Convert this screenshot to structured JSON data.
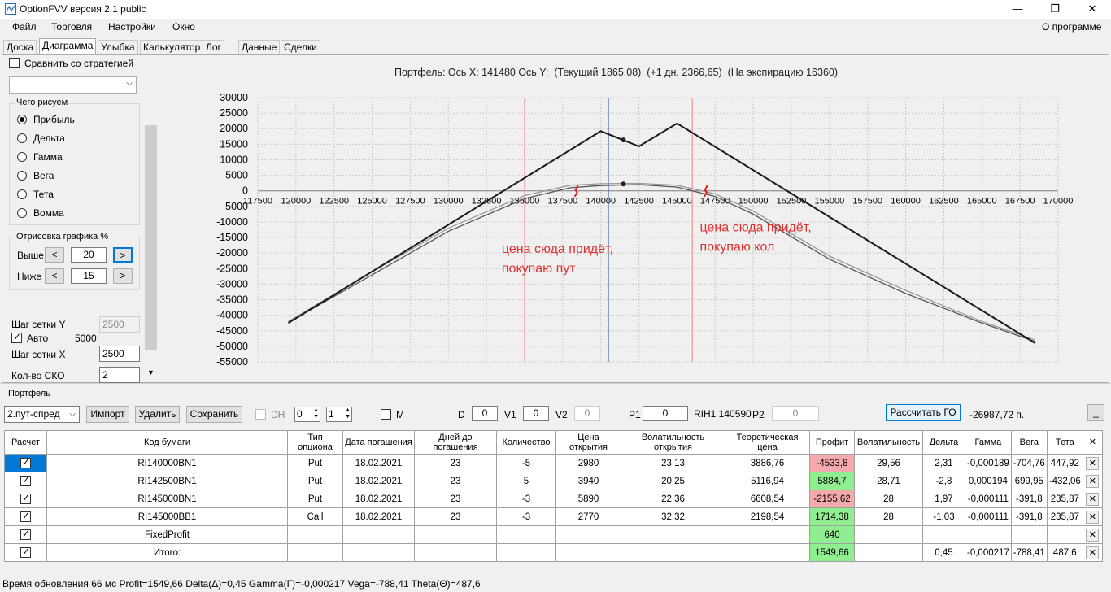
{
  "window": {
    "title": "OptionFVV версия 2.1 public",
    "minimize": "—",
    "maximize": "❐",
    "close": "✕"
  },
  "menu": {
    "items": [
      "Файл",
      "Торговля",
      "Настройки",
      "Окно"
    ],
    "about": "О программе"
  },
  "tabs": [
    "Доска",
    "Диаграмма",
    "Улыбка",
    "Калькулятор",
    "Лог",
    "Данные",
    "Сделки"
  ],
  "active_tab": "Диаграмма",
  "left_panel": {
    "compare_label": "Сравнить со стратегией",
    "draw_group_label": "Чего рисуем",
    "draw_options": [
      "Прибыль",
      "Дельта",
      "Гамма",
      "Вега",
      "Тета",
      "Вомма"
    ],
    "selected_option": "Прибыль",
    "render_group_label": "Отрисовка графика %",
    "above_label": "Выше",
    "above_value": "20",
    "below_label": "Ниже",
    "below_value": "15",
    "grid_y_label": "Шаг сетки Y",
    "grid_y_value": "2500",
    "auto_label": "Авто",
    "auto_value": "5000",
    "grid_x_label": "Шаг сетки X",
    "grid_x_value": "2500",
    "sko_label": "Кол-во СКО",
    "sko_value": "2"
  },
  "chart_header": "Портфель: Ось X: 141480 Ось Y:  (Текущий 1865,08)  (+1 дн. 2366,65)  (На экспирацию 16360)",
  "chart_data": {
    "type": "line",
    "xlim": [
      117500,
      170000
    ],
    "ylim": [
      -55000,
      30000
    ],
    "x_ticks": [
      117500,
      120000,
      122500,
      125000,
      127500,
      130000,
      132500,
      135000,
      137500,
      140000,
      142500,
      145000,
      147500,
      150000,
      152500,
      155000,
      157500,
      160000,
      162500,
      165000,
      167500,
      170000
    ],
    "y_ticks": [
      30000,
      25000,
      20000,
      15000,
      10000,
      5000,
      0,
      -5000,
      -10000,
      -15000,
      -20000,
      -25000,
      -30000,
      -35000,
      -40000,
      -45000,
      -50000,
      -55000
    ],
    "grid": true,
    "series": [
      {
        "color": "#1a1a1a",
        "x": [
          119500,
          140000,
          142500,
          145000,
          168500
        ],
        "y": [
          -42500,
          19200,
          14300,
          21700,
          -49000
        ]
      },
      {
        "color": "#555555",
        "x": [
          119500,
          125000,
          130000,
          135000,
          138000,
          140000,
          141480,
          142500,
          145000,
          147500,
          150000,
          155000,
          160000,
          165000,
          168500
        ],
        "y": [
          -42300,
          -27000,
          -13000,
          -2500,
          1000,
          1700,
          1865,
          2000,
          1200,
          -1800,
          -7500,
          -22000,
          -33000,
          -42500,
          -48500
        ]
      },
      {
        "color": "#999999",
        "x": [
          119500,
          125000,
          130000,
          135000,
          138000,
          140000,
          141480,
          142500,
          145000,
          147500,
          150000,
          155000,
          160000,
          165000,
          168500
        ],
        "y": [
          -42000,
          -26000,
          -12000,
          -1500,
          1800,
          2300,
          2367,
          2400,
          1800,
          -1000,
          -6500,
          -21000,
          -32000,
          -42000,
          -48000
        ]
      }
    ],
    "points": [
      {
        "x": 141480,
        "y": 16360
      },
      {
        "x": 141480,
        "y": 2200
      }
    ],
    "vlines": [
      {
        "x": 135000,
        "color": "#f08080"
      },
      {
        "x": 140500,
        "color": "#4060b0"
      },
      {
        "x": 146000,
        "color": "#f08080"
      }
    ],
    "markers": [
      {
        "x": 138500,
        "y": 0
      },
      {
        "x": 147000,
        "y": 0
      }
    ],
    "annotations": [
      {
        "lines": [
          "цена сюда придёт,",
          "покупаю пут"
        ],
        "x": 133500,
        "y": -20000,
        "color": "#e03030"
      },
      {
        "lines": [
          "цена сюда придёт,",
          "покупаю кол"
        ],
        "x": 146500,
        "y": -13000,
        "color": "#e03030"
      }
    ]
  },
  "portfolio": {
    "label": "Портфель",
    "selected": "2.пут-спред",
    "import": "Импорт",
    "delete": "Удалить",
    "save": "Сохранить",
    "dh_label": "DH",
    "spin1": "0",
    "spin2": "1",
    "m_label": "M",
    "d_label": "D",
    "d_value": "0",
    "v1_label": "V1",
    "v1_value": "0",
    "v2_label": "V2",
    "v2_value": "0",
    "p1_label": "P1",
    "p1_value": "0",
    "rih_label": "RIH1 140590",
    "p2_label": "P2",
    "p2_value": "0",
    "calc_go": "Рассчитать ГО",
    "go_value": "-26987,72 п.",
    "minimize": "_"
  },
  "table": {
    "headers": [
      "Расчет",
      "Код бумаги",
      "Тип опциона",
      "Дата погашения",
      "Дней до погашения",
      "Количество",
      "Цена открытия",
      "Волатильность открытия",
      "Теоретическая цена",
      "Профит",
      "Волатильность",
      "Дельта",
      "Гамма",
      "Вега",
      "Тета",
      "✕"
    ],
    "rows": [
      [
        "",
        "RI140000BN1",
        "Put",
        "18.02.2021",
        "23",
        "-5",
        "2980",
        "23,13",
        "3886,76",
        "-4533,8",
        "29,56",
        "2,31",
        "-0,000189",
        "-704,76",
        "447,92"
      ],
      [
        "",
        "RI142500BN1",
        "Put",
        "18.02.2021",
        "23",
        "5",
        "3940",
        "20,25",
        "5116,94",
        "5884,7",
        "28,71",
        "-2,8",
        "0,000194",
        "699,95",
        "-432,06"
      ],
      [
        "",
        "RI145000BN1",
        "Put",
        "18.02.2021",
        "23",
        "-3",
        "5890",
        "22,36",
        "6608,54",
        "-2155,62",
        "28",
        "1,97",
        "-0,000111",
        "-391,8",
        "235,87"
      ],
      [
        "",
        "RI145000BB1",
        "Call",
        "18.02.2021",
        "23",
        "-3",
        "2770",
        "32,32",
        "2198,54",
        "1714,38",
        "28",
        "-1,03",
        "-0,000111",
        "-391,8",
        "235,87"
      ],
      [
        "",
        "FixedProfit",
        "",
        "",
        "",
        "",
        "",
        "",
        "",
        "640",
        "",
        "",
        "",
        "",
        ""
      ],
      [
        "",
        "Итого:",
        "",
        "",
        "",
        "",
        "",
        "",
        "",
        "1549,66",
        "",
        "0,45",
        "-0,000217",
        "-788,41",
        "487,6"
      ]
    ],
    "profit_colors": [
      "pink",
      "green",
      "pink",
      "green",
      "green",
      "green"
    ],
    "row_close": "✕"
  },
  "status": "Время обновления 66 мс  Profit=1549,66 Delta(Δ)=0,45 Gamma(Г)=-0,000217 Vega=-788,41 Theta(Θ)=487,6"
}
